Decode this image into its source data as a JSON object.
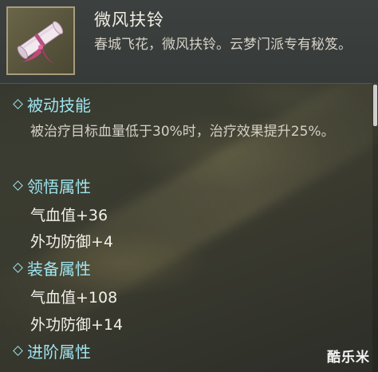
{
  "item": {
    "name": "微风扶铃",
    "description": "春城飞花，微风扶铃。云梦门派专有秘笈。",
    "icon": "scroll-icon"
  },
  "sections": {
    "passive": {
      "title": "被动技能",
      "text": "被治疗目标血量低于30%时，治疗效果提升25%。"
    },
    "comprehension": {
      "title": "领悟属性",
      "stats": [
        "气血值+36",
        "外功防御+4"
      ]
    },
    "equipment": {
      "title": "装备属性",
      "stats": [
        "气血值+108",
        "外功防御+14"
      ]
    },
    "advanced": {
      "title": "进阶属性"
    }
  },
  "watermark": "酷乐米",
  "colors": {
    "heading": "#9ee4ee",
    "stat": "#f3f1ea",
    "description": "#d4d0c6",
    "item_frame": "#a89d7a"
  }
}
